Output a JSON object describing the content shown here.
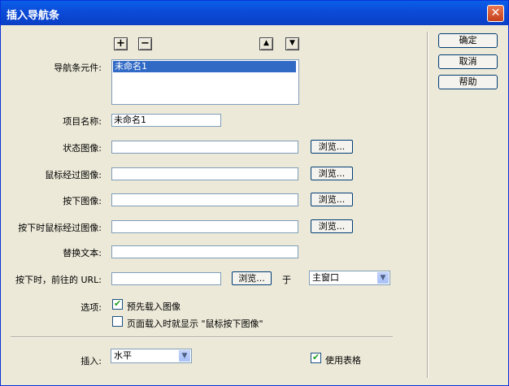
{
  "window": {
    "title": "插入导航条"
  },
  "toolbar": {
    "add": "+",
    "remove": "−",
    "up": "▲",
    "down": "▼"
  },
  "nav_elements": {
    "label": "导航条元件:",
    "items": [
      "未命名1"
    ]
  },
  "item_name": {
    "label": "项目名称:",
    "value": "未命名1"
  },
  "state_image": {
    "label": "状态图像:",
    "value": "",
    "browse": "浏览..."
  },
  "rollover_image": {
    "label": "鼠标经过图像:",
    "value": "",
    "browse": "浏览..."
  },
  "down_image": {
    "label": "按下图像:",
    "value": "",
    "browse": "浏览..."
  },
  "down_rollover_image": {
    "label": "按下时鼠标经过图像:",
    "value": "",
    "browse": "浏览..."
  },
  "alt_text": {
    "label": "替换文本:",
    "value": ""
  },
  "url": {
    "label": "按下时，前往的 URL:",
    "value": "",
    "browse": "浏览...",
    "in_label": "于",
    "target": "主窗口"
  },
  "options": {
    "label": "选项:",
    "preload": {
      "label": "预先载入图像",
      "checked": true
    },
    "show_down": {
      "label": "页面载入时就显示 \"鼠标按下图像\"",
      "checked": false
    }
  },
  "insert": {
    "label": "插入:",
    "value": "水平"
  },
  "use_tables": {
    "label": "使用表格",
    "checked": true
  },
  "buttons": {
    "ok": "确定",
    "cancel": "取消",
    "help": "帮助"
  },
  "colors": {
    "titlebar": "#0a5fe8",
    "dialog_bg": "#ece9d8",
    "selection": "#316ac5"
  }
}
